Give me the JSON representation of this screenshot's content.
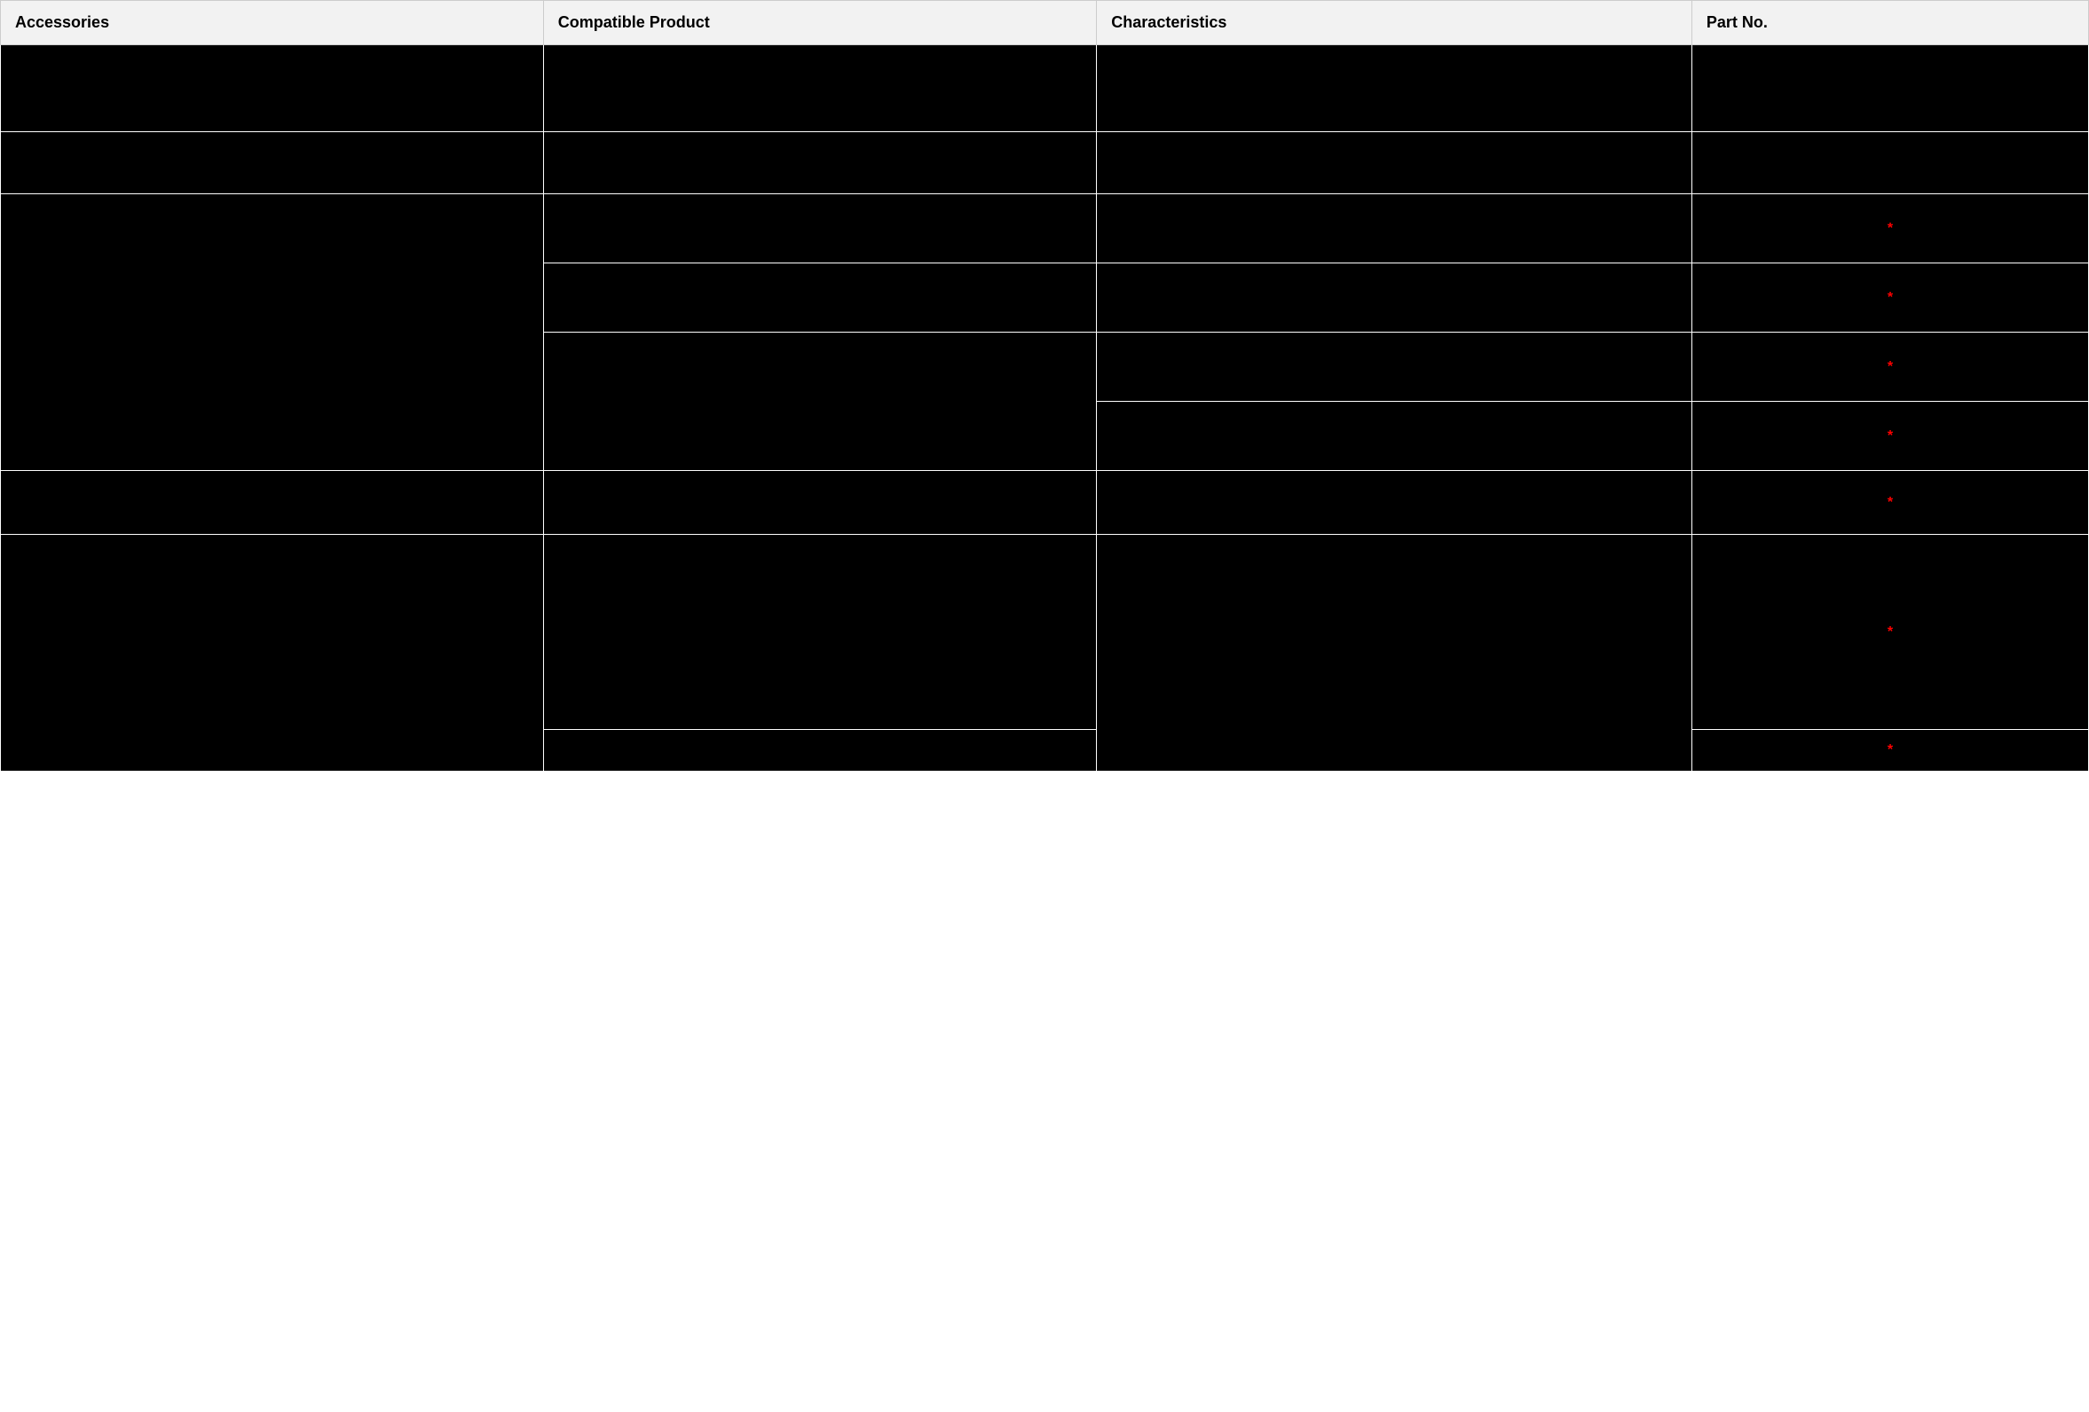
{
  "headers": {
    "accessories": "Accessories",
    "compatible": "Compatible Product",
    "characteristics": "Characteristics",
    "partno": "Part No."
  },
  "asterisk": "*"
}
